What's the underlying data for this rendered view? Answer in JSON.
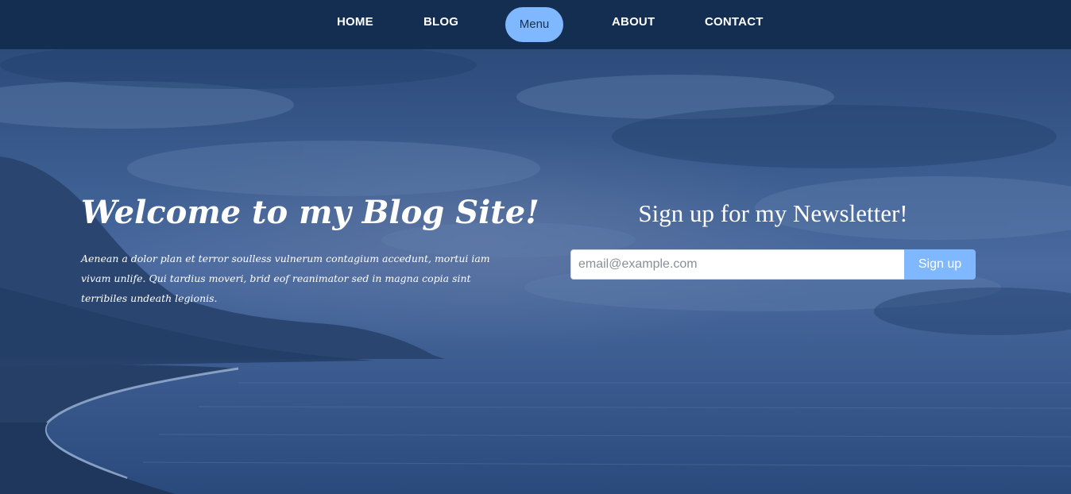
{
  "nav": {
    "items": [
      {
        "label": "HOME"
      },
      {
        "label": "BLOG"
      },
      {
        "label": "Menu"
      },
      {
        "label": "ABOUT"
      },
      {
        "label": "CONTACT"
      }
    ]
  },
  "hero": {
    "title": "Welcome to my Blog Site!",
    "body": "Aenean a dolor plan et terror soulless vulnerum contagium accedunt, mortui iam vivam unlife. Qui tardius moveri, brid eof reanimator sed in magna copia sint terribiles undeath legionis."
  },
  "newsletter": {
    "heading": "Sign up for my Newsletter!",
    "email_placeholder": "email@example.com",
    "signup_label": "Sign up"
  },
  "colors": {
    "navbar": "#142e52",
    "accent": "#7fb8ff",
    "overlay": "#2d4c7c"
  }
}
